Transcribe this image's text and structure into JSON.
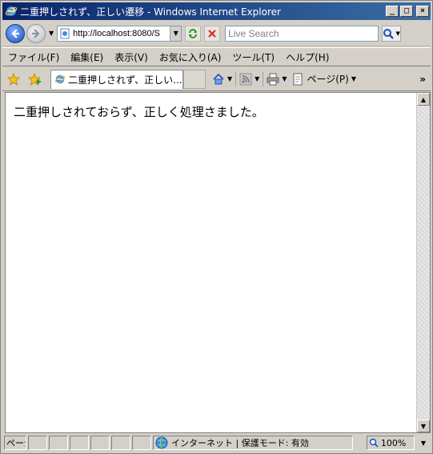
{
  "window": {
    "title": "二重押しされず、正しい遷移 - Windows Internet Explorer",
    "minimize": "_",
    "maximize": "□",
    "close": "×"
  },
  "address_bar": {
    "url": "http://localhost:8080/S",
    "search_placeholder": "Live Search"
  },
  "menu": {
    "items": [
      "ファイル(F)",
      "編集(E)",
      "表示(V)",
      "お気に入り(A)",
      "ツール(T)",
      "ヘルプ(H)"
    ]
  },
  "tabs": {
    "active_label": "二重押しされず、正しい..."
  },
  "command_bar": {
    "page_label": "ページ(P)",
    "overflow": "»"
  },
  "content": {
    "message": "二重押しされておらず、正しく処理さました。"
  },
  "status_bar": {
    "first_pane": "ページ",
    "zone": "インターネット | 保護モード: 有効",
    "zoom": "100%"
  },
  "colors": {
    "titlebar_start": "#0a246a",
    "titlebar_end": "#3a6ea5",
    "chrome": "#d4d0c8"
  },
  "icons": [
    "ie-logo-icon",
    "back-arrow-icon",
    "forward-arrow-icon",
    "page-icon",
    "refresh-icon",
    "stop-icon",
    "search-icon",
    "favorites-star-icon",
    "add-favorites-icon",
    "home-icon",
    "rss-feed-icon",
    "print-icon",
    "page-menu-icon",
    "globe-icon",
    "zoom-icon"
  ]
}
